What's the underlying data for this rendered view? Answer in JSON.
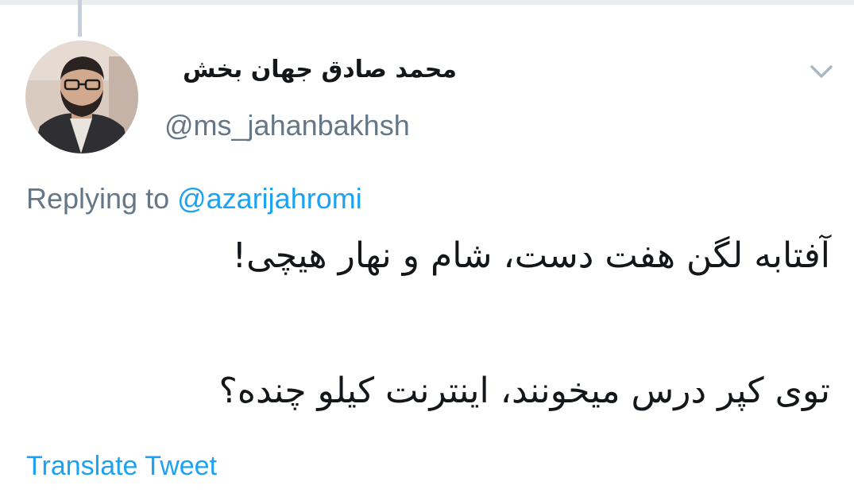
{
  "author": {
    "display_name": "محمد صادق جهان بخش",
    "handle": "@ms_jahanbakhsh"
  },
  "reply": {
    "prefix": "Replying to ",
    "mention": "@azarijahromi"
  },
  "tweet": {
    "lines": [
      "آفتابه لگن هفت دست، شام و نهار هیچی!",
      "توی کپر درس میخونند، اینترنت کیلو چنده؟"
    ]
  },
  "actions": {
    "translate": "Translate Tweet"
  },
  "icons": {
    "menu": "chevron-down-icon"
  },
  "colors": {
    "text": "#14171a",
    "secondary": "#657786",
    "link": "#1da1f2"
  }
}
